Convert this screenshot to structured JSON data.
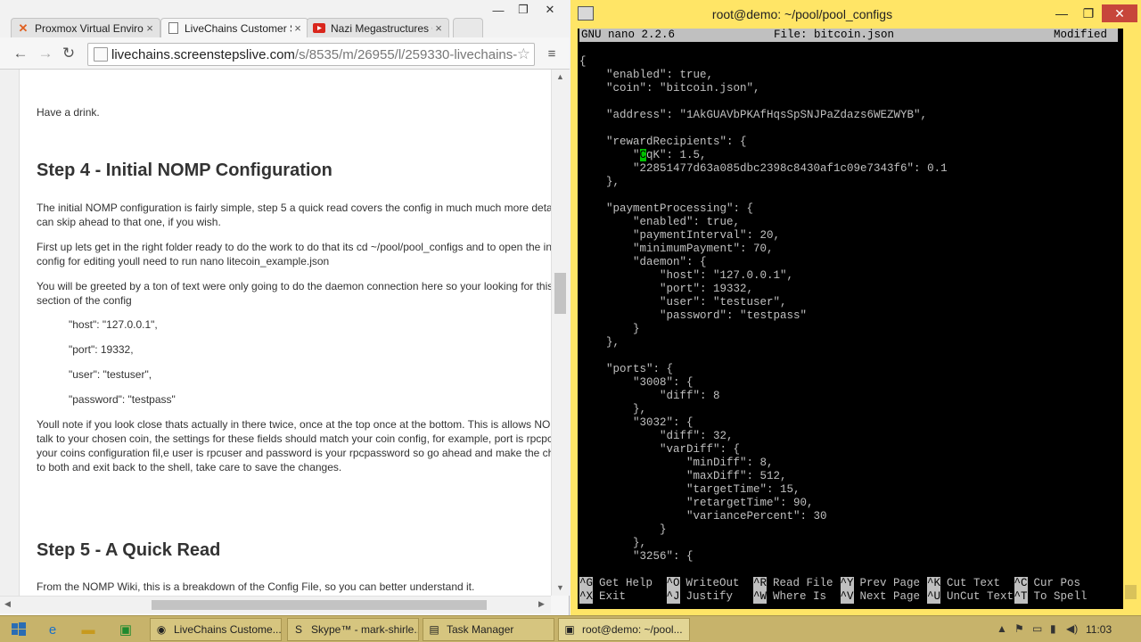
{
  "browser": {
    "tabs": [
      {
        "label": "Proxmox Virtual Enviro",
        "icon": "proxmox-icon",
        "active": false
      },
      {
        "label": "LiveChains Customer S",
        "icon": "document-icon",
        "active": true
      },
      {
        "label": "Nazi Megastructures 0",
        "icon": "youtube-icon",
        "active": false
      }
    ],
    "url_host": "livechains.screenstepslive.com",
    "url_path": "/s/8535/m/26955/l/259330-livechains-"
  },
  "page": {
    "intro": "Have a drink.",
    "step4_heading": "Step 4 - Initial NOMP Configuration",
    "p1_line1": "The initial NOMP configuration is fairly simple, step 5 a quick read covers the config in much much more deta",
    "p1_line2": "can skip ahead to that one, if you wish.",
    "p2_line1": "First up lets get in the right folder ready to do the work to do that its cd ~/pool/pool_configs and to open the in",
    "p2_line2": "config for editing youll need to run nano litecoin_example.json",
    "p3_line1": "You will be greeted by a ton of text were only going to do the daemon connection here so your looking for this",
    "p3_line2": "section of the config",
    "code_host": "\"host\": \"127.0.0.1\",",
    "code_port": "\"port\": 19332,",
    "code_user": "\"user\": \"testuser\",",
    "code_password": "\"password\": \"testpass\"",
    "p4_line1": "Youll note if you look close thats actually in there twice, once at the top once at the bottom. This is allows NO",
    "p4_line2": "talk to your chosen coin, the settings for these fields should match your coin config, for example, port is rpcpc",
    "p4_line3": "your coins configuration fil,e user is rpcuser and password is your rpcpassword so go ahead and make the ch",
    "p4_line4": "to both and exit back to the shell, take care to save the changes.",
    "step5_heading": "Step 5 - A Quick Read",
    "p5_line1": "From the NOMP Wiki, this is a breakdown of the Config File, so you can better understand it."
  },
  "putty": {
    "title": "root@demo: ~/pool/pool_configs",
    "nano_version": "GNU nano 2.2.6",
    "file_label": "File: bitcoin.json",
    "status": "Modified",
    "lines": [
      "{",
      "    \"enabled\": true,",
      "    \"coin\": \"bitcoin.json\",",
      "",
      "    \"address\": \"1AkGUAVbPKAfHqsSpSNJPaZdazs6WEZWYB\",",
      "",
      "    \"rewardRecipients\": {",
      "        \"CqK\": 1.5,",
      "        \"22851477d63a085dbc2398c8430af1c09e7343f6\": 0.1",
      "    },",
      "",
      "    \"paymentProcessing\": {",
      "        \"enabled\": true,",
      "        \"paymentInterval\": 20,",
      "        \"minimumPayment\": 70,",
      "        \"daemon\": {",
      "            \"host\": \"127.0.0.1\",",
      "            \"port\": 19332,",
      "            \"user\": \"testuser\",",
      "            \"password\": \"testpass\"",
      "        }",
      "    },",
      "",
      "    \"ports\": {",
      "        \"3008\": {",
      "            \"diff\": 8",
      "        },",
      "        \"3032\": {",
      "            \"diff\": 32,",
      "            \"varDiff\": {",
      "                \"minDiff\": 8,",
      "                \"maxDiff\": 512,",
      "                \"targetTime\": 15,",
      "                \"retargetTime\": 90,",
      "                \"variancePercent\": 30",
      "            }",
      "        },",
      "        \"3256\": {"
    ],
    "shortcuts_row1": [
      {
        "key": "^G",
        "label": "Get Help"
      },
      {
        "key": "^O",
        "label": "WriteOut"
      },
      {
        "key": "^R",
        "label": "Read File"
      },
      {
        "key": "^Y",
        "label": "Prev Page"
      },
      {
        "key": "^K",
        "label": "Cut Text"
      },
      {
        "key": "^C",
        "label": "Cur Pos"
      }
    ],
    "shortcuts_row2": [
      {
        "key": "^X",
        "label": "Exit"
      },
      {
        "key": "^J",
        "label": "Justify"
      },
      {
        "key": "^W",
        "label": "Where Is"
      },
      {
        "key": "^V",
        "label": "Next Page"
      },
      {
        "key": "^U",
        "label": "UnCut Text"
      },
      {
        "key": "^T",
        "label": "To Spell"
      }
    ]
  },
  "taskbar": {
    "buttons": [
      {
        "label": "LiveChains Custome...",
        "icon": "chrome-icon"
      },
      {
        "label": "Skype™ - mark-shirle...",
        "icon": "skype-icon"
      },
      {
        "label": "Task Manager",
        "icon": "task-manager-icon"
      },
      {
        "label": "root@demo: ~/pool...",
        "icon": "putty-icon"
      }
    ],
    "clock": "11:03"
  },
  "colors": {
    "putty_frame": "#ffe566",
    "taskbar": "#c7b36b",
    "cursor": "#00c000"
  }
}
